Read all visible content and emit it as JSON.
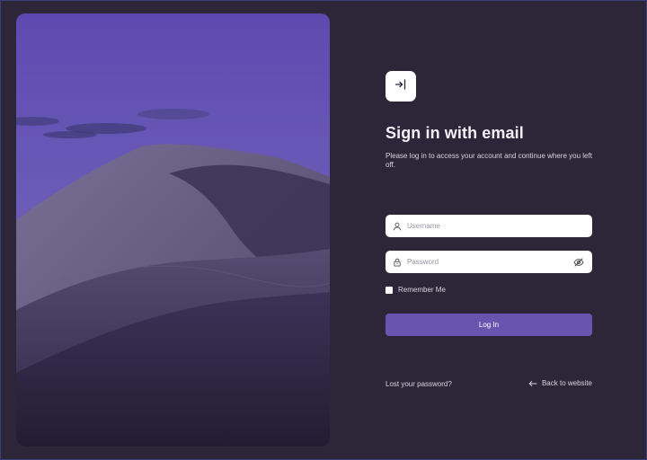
{
  "login": {
    "title": "Sign in with email",
    "subtitle": "Please log in to access your account and continue where you left off.",
    "username": {
      "value": "",
      "placeholder": "Username"
    },
    "password": {
      "value": "",
      "placeholder": "Password"
    },
    "remember_label": "Remember Me",
    "remember_checked": false,
    "login_button": "Log In",
    "lost_password": "Lost your password?",
    "back_link": "Back to website"
  },
  "icons": {
    "logo": "login-arrow-icon",
    "username": "user-icon",
    "password": "lock-icon",
    "password_toggle": "eye-off-icon",
    "back": "arrow-left-icon"
  },
  "colors": {
    "background": "#2d2638",
    "accent": "#6b54b0",
    "text": "#f2f0f6"
  }
}
